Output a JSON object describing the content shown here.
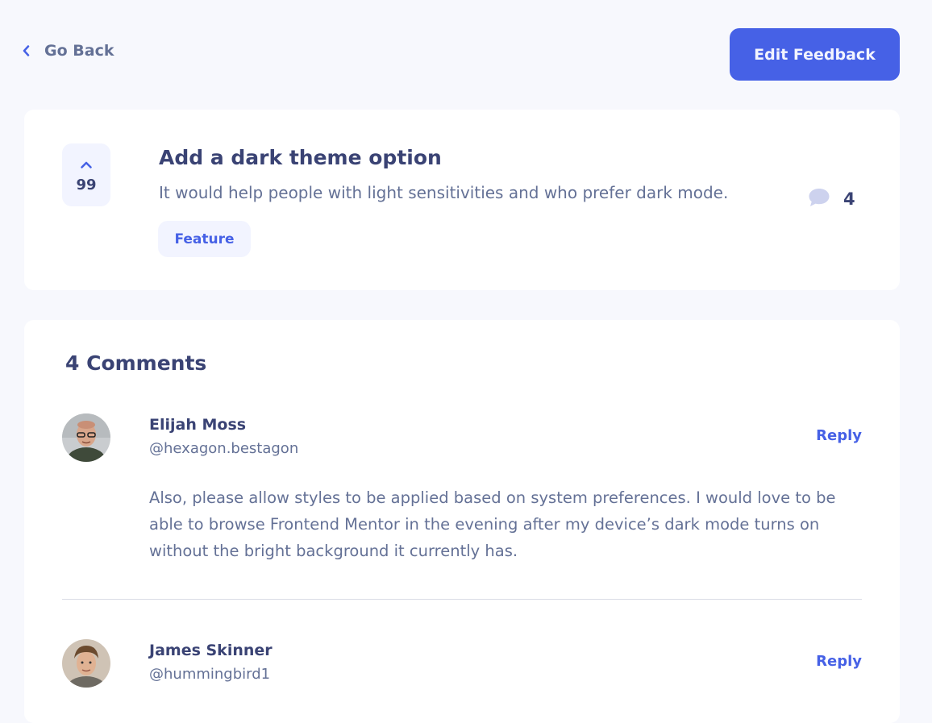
{
  "nav": {
    "back_label": "Go Back",
    "edit_label": "Edit Feedback"
  },
  "feedback": {
    "upvotes": "99",
    "title": "Add a dark theme option",
    "description": "It would help people with light sensitivities and who prefer dark mode.",
    "category": "Feature",
    "comment_count": "4"
  },
  "comments_section": {
    "heading": "4 Comments",
    "items": [
      {
        "name": "Elijah Moss",
        "handle": "@hexagon.bestagon",
        "reply_label": "Reply",
        "body": "Also, please allow styles to be applied based on system preferences. I would love to be able to browse Frontend Mentor in the evening after my device’s dark mode turns on without the bright background it currently has."
      },
      {
        "name": "James Skinner",
        "handle": "@hummingbird1",
        "reply_label": "Reply"
      }
    ]
  },
  "colors": {
    "background": "#F7F8FD",
    "primary": "#4661E6",
    "heading": "#3A4374",
    "muted": "#647196",
    "tag_bg": "#F2F4FF"
  }
}
